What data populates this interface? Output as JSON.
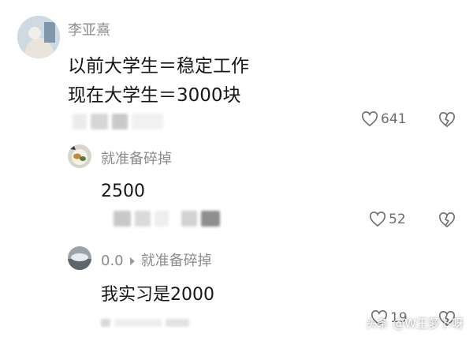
{
  "comments": [
    {
      "username": "李亚熹",
      "lines": [
        "以前大学生＝稳定工作",
        "现在大学生＝3000块"
      ],
      "likes": "641"
    },
    {
      "username": "就准备碎掉",
      "lines": [
        "2500"
      ],
      "likes": "52"
    },
    {
      "reply_from": "0.0",
      "reply_to": "就准备碎掉",
      "lines": [
        "我实习是2000"
      ],
      "likes": "19"
    }
  ],
  "watermark": {
    "logo": "头条",
    "handle": "@W王萝卜呀"
  },
  "colors": {
    "username": "#8c8c8c",
    "text": "#161616",
    "icon": "#6e6e6e"
  },
  "icons": {
    "like": "heart-icon",
    "dislike": "broken-heart-icon",
    "reply": "play-arrow-icon"
  }
}
